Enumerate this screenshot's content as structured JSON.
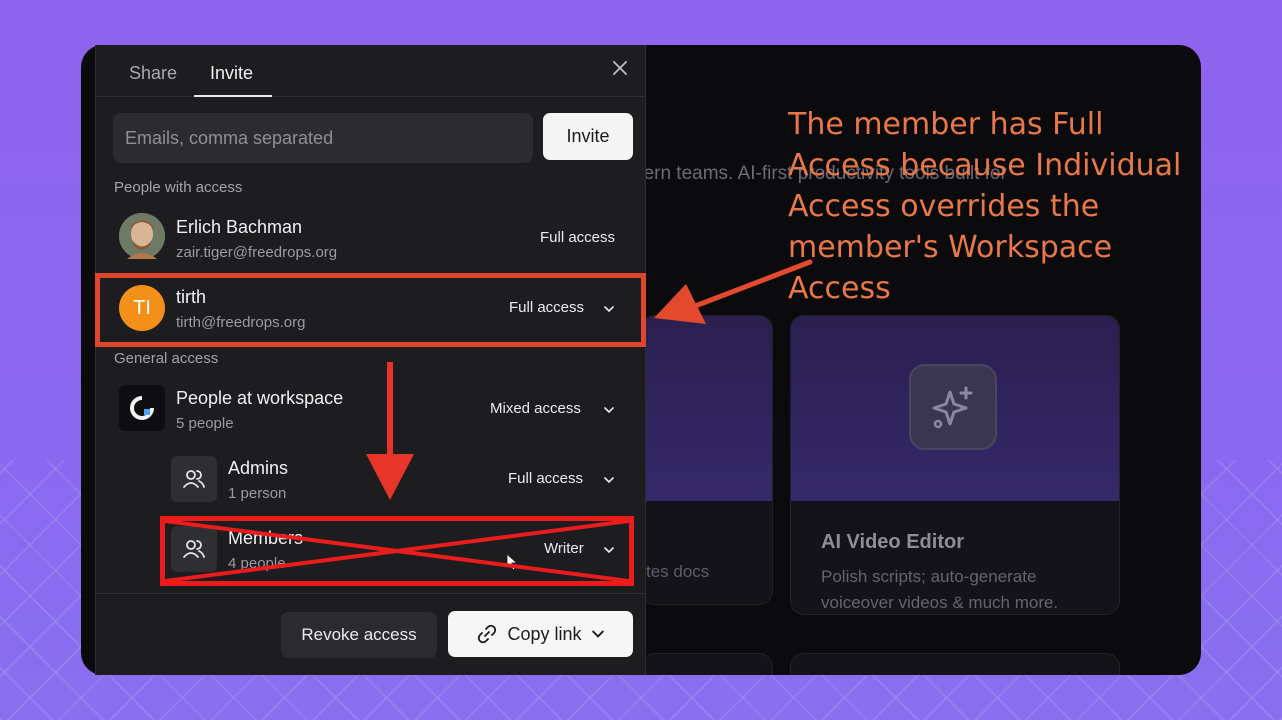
{
  "background": {
    "subtitle_fragment": "dern teams. AI-first productivity tools built for",
    "card2": {
      "title": "AI Video Editor",
      "description": "Polish scripts; auto-generate voiceover videos & much more."
    },
    "card1_desc_fragment": "tes docs"
  },
  "modal": {
    "tabs": [
      {
        "label": "Share",
        "active": false
      },
      {
        "label": "Invite",
        "active": true
      }
    ],
    "close_icon": "close-icon",
    "email_placeholder": "Emails, comma separated",
    "invite_label": "Invite",
    "people_section_label": "People with access",
    "people": [
      {
        "name": "Erlich Bachman",
        "email": "zair.tiger@freedrops.org",
        "access": "Full access",
        "has_dropdown": false
      },
      {
        "name": "tirth",
        "initials": "TI",
        "email": "tirth@freedrops.org",
        "access": "Full access",
        "has_dropdown": true
      }
    ],
    "general_section_label": "General access",
    "general": [
      {
        "name": "People at workspace",
        "count": "5 people",
        "access": "Mixed access"
      },
      {
        "name": "Admins",
        "count": "1 person",
        "access": "Full access"
      },
      {
        "name": "Members",
        "count": "4 people",
        "access": "Writer"
      }
    ],
    "footer": {
      "revoke_label": "Revoke access",
      "copy_label": "Copy link"
    }
  },
  "annotation": {
    "text": "The member has Full Access because Individual Access overrides the member's Workspace Access",
    "color": "#e87749"
  },
  "colors": {
    "highlight_box": "#e0452e",
    "cross_box": "#ea1c1c",
    "avatar_orange": "#f39019"
  }
}
